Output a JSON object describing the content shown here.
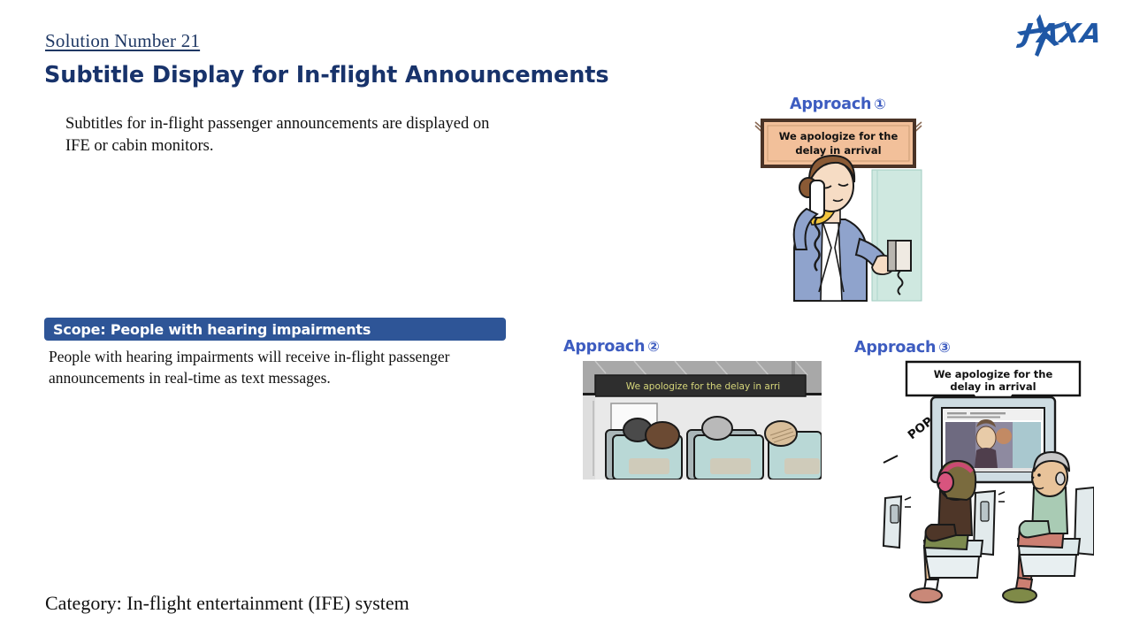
{
  "logo": {
    "name": "JAXA",
    "color": "#1F57A5"
  },
  "header": {
    "solution_number": "Solution Number 21",
    "title": "Subtitle Display for In-flight Announcements",
    "title_color": "#18336B",
    "solution_number_color": "#1F3864"
  },
  "body": {
    "intro": "Subtitles for in-flight passenger announcements are displayed on IFE or cabin monitors.",
    "scope_label": "Scope: People with hearing impairments",
    "scope_banner_color": "#2E5597",
    "scope_text": "People with hearing impairments will receive in-flight passenger announcements in real-time as text messages.",
    "category": "Category: In-flight entertainment (IFE) system"
  },
  "approaches": [
    {
      "heading": "Approach",
      "number": "①",
      "heading_color": "#3D5CC0",
      "sign_text_line1": "We apologize for the",
      "sign_text_line2": "delay in arrival",
      "sign_fill": "#F2C09A",
      "sign_border": "#4A3326",
      "caption": "Cabin attendant making a PA announcement with bulkhead sign"
    },
    {
      "heading": "Approach",
      "number": "②",
      "heading_color": "#3D5CC0",
      "banner_text": "We apologize for the delay in arri",
      "banner_bg": "#2E2E2E",
      "banner_text_color": "#D6D67A",
      "caption": "Overhead cabin monitor displaying scrolling subtitle above seated passengers"
    },
    {
      "heading": "Approach",
      "number": "③",
      "heading_color": "#3D5CC0",
      "callout_line1": "We apologize for the",
      "callout_line2": "delay in arrival",
      "popup_label": "POP UP",
      "caption": "Seat-back IFE monitor with pop-up subtitle and two seated passengers"
    }
  ]
}
